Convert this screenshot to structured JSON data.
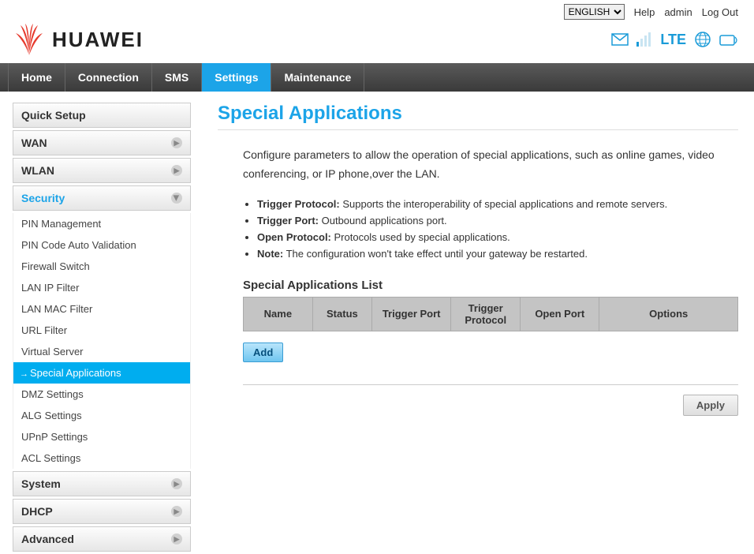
{
  "top": {
    "language": "ENGLISH",
    "help": "Help",
    "user": "admin",
    "logout": "Log Out"
  },
  "brand": "HUAWEI",
  "status": {
    "lte": "LTE"
  },
  "nav": {
    "home": "Home",
    "connection": "Connection",
    "sms": "SMS",
    "settings": "Settings",
    "maintenance": "Maintenance"
  },
  "sidebar": {
    "quick_setup": "Quick Setup",
    "wan": "WAN",
    "wlan": "WLAN",
    "security": "Security",
    "security_items": [
      "PIN Management",
      "PIN Code Auto Validation",
      "Firewall Switch",
      "LAN IP Filter",
      "LAN MAC Filter",
      "URL Filter",
      "Virtual Server",
      "Special Applications",
      "DMZ Settings",
      "ALG Settings",
      "UPnP Settings",
      "ACL Settings"
    ],
    "system": "System",
    "dhcp": "DHCP",
    "advanced": "Advanced"
  },
  "page": {
    "title": "Special Applications",
    "desc": "Configure parameters to allow the operation of special applications, such as online games, video conferencing, or IP phone,over the LAN.",
    "b1_label": "Trigger Protocol:",
    "b1_text": " Supports the interoperability of special applications and remote servers.",
    "b2_label": "Trigger Port:",
    "b2_text": " Outbound applications port.",
    "b3_label": "Open Protocol:",
    "b3_text": " Protocols used by special applications.",
    "b4_label": "Note:",
    "b4_text": " The configuration won't take effect until your gateway be restarted.",
    "list_title": "Special Applications List",
    "cols": {
      "name": "Name",
      "status": "Status",
      "trigger_port": "Trigger Port",
      "trigger_protocol": "Trigger Protocol",
      "open_port": "Open Port",
      "options": "Options"
    },
    "add": "Add",
    "apply": "Apply"
  }
}
